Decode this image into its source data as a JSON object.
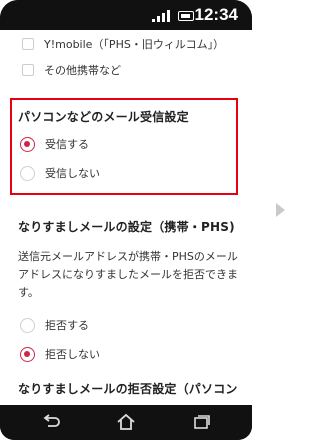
{
  "status": {
    "time": "12:34"
  },
  "options_top": [
    {
      "label": "Y!mobile（「PHS・旧ウィルコム」）"
    },
    {
      "label": "その他携帯など"
    }
  ],
  "mail_setting": {
    "heading": "パソコンなどのメール受信設定",
    "options": [
      {
        "label": "受信する",
        "selected": true
      },
      {
        "label": "受信しない",
        "selected": false
      }
    ]
  },
  "spoof_setting": {
    "heading": "なりすましメールの設定（携帯・PHS)",
    "description": "送信元メールアドレスが携帯・PHSのメールアドレスになりすましたメールを拒否できます。",
    "options": [
      {
        "label": "拒否する",
        "selected": false
      },
      {
        "label": "拒否しない",
        "selected": true
      }
    ]
  },
  "spoof_reject_heading": "なりすましメールの拒否設定（パソコン",
  "colors": {
    "accent": "#cc2747",
    "highlight_border": "#e60012"
  },
  "icons": {
    "back": "back-icon",
    "home": "home-icon",
    "recent": "recent-apps-icon",
    "next": "next-arrow-icon"
  }
}
